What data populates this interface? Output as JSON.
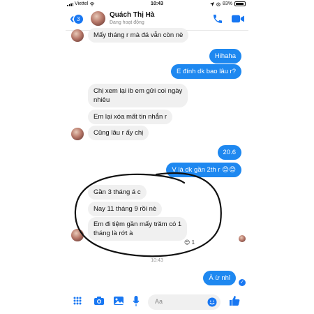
{
  "status_bar": {
    "carrier": "Viettel",
    "time": "10:43",
    "battery": "83%"
  },
  "header": {
    "back_count": "3",
    "name": "Quách Thị Hà",
    "status": "Đang hoạt động"
  },
  "messages": [
    {
      "side": "in",
      "text": "Mấy tháng r mà đá vẫn còn nè"
    },
    {
      "side": "out",
      "text": "Hihaha"
    },
    {
      "side": "out",
      "text": "E đính dk bao lâu r?"
    },
    {
      "side": "in",
      "text": "Chị xem lại ib em gửi coi ngày"
    },
    {
      "side": "in",
      "text": "nhiêu"
    },
    {
      "side": "in",
      "text": "Em lại xóa mất tin nhắn r"
    },
    {
      "side": "in",
      "text": "Cũng lâu r ấy chị"
    },
    {
      "side": "out",
      "text": "20.6"
    },
    {
      "side": "out",
      "text": "V là dk gần 2th r 😊😊"
    },
    {
      "side": "in",
      "text": "Gần 3 tháng á c"
    },
    {
      "side": "in",
      "text": "Nay 11 tháng 9 rồi nè"
    },
    {
      "side": "in",
      "text": "Em đi tiệm gần mấy trăm có 1"
    },
    {
      "side": "in",
      "text": "tháng là rớt à"
    },
    {
      "side": "out",
      "text": "À ừ nhỉ"
    }
  ],
  "reaction": {
    "emoji": "😍",
    "count": "1"
  },
  "timestamp": "10:43",
  "composer": {
    "placeholder": "Aa"
  },
  "colors": {
    "accent": "#1877f2",
    "outgoing_bubble": "#1e88f0",
    "incoming_bubble": "#f0f0f0",
    "annotation_circle": "#111111"
  }
}
